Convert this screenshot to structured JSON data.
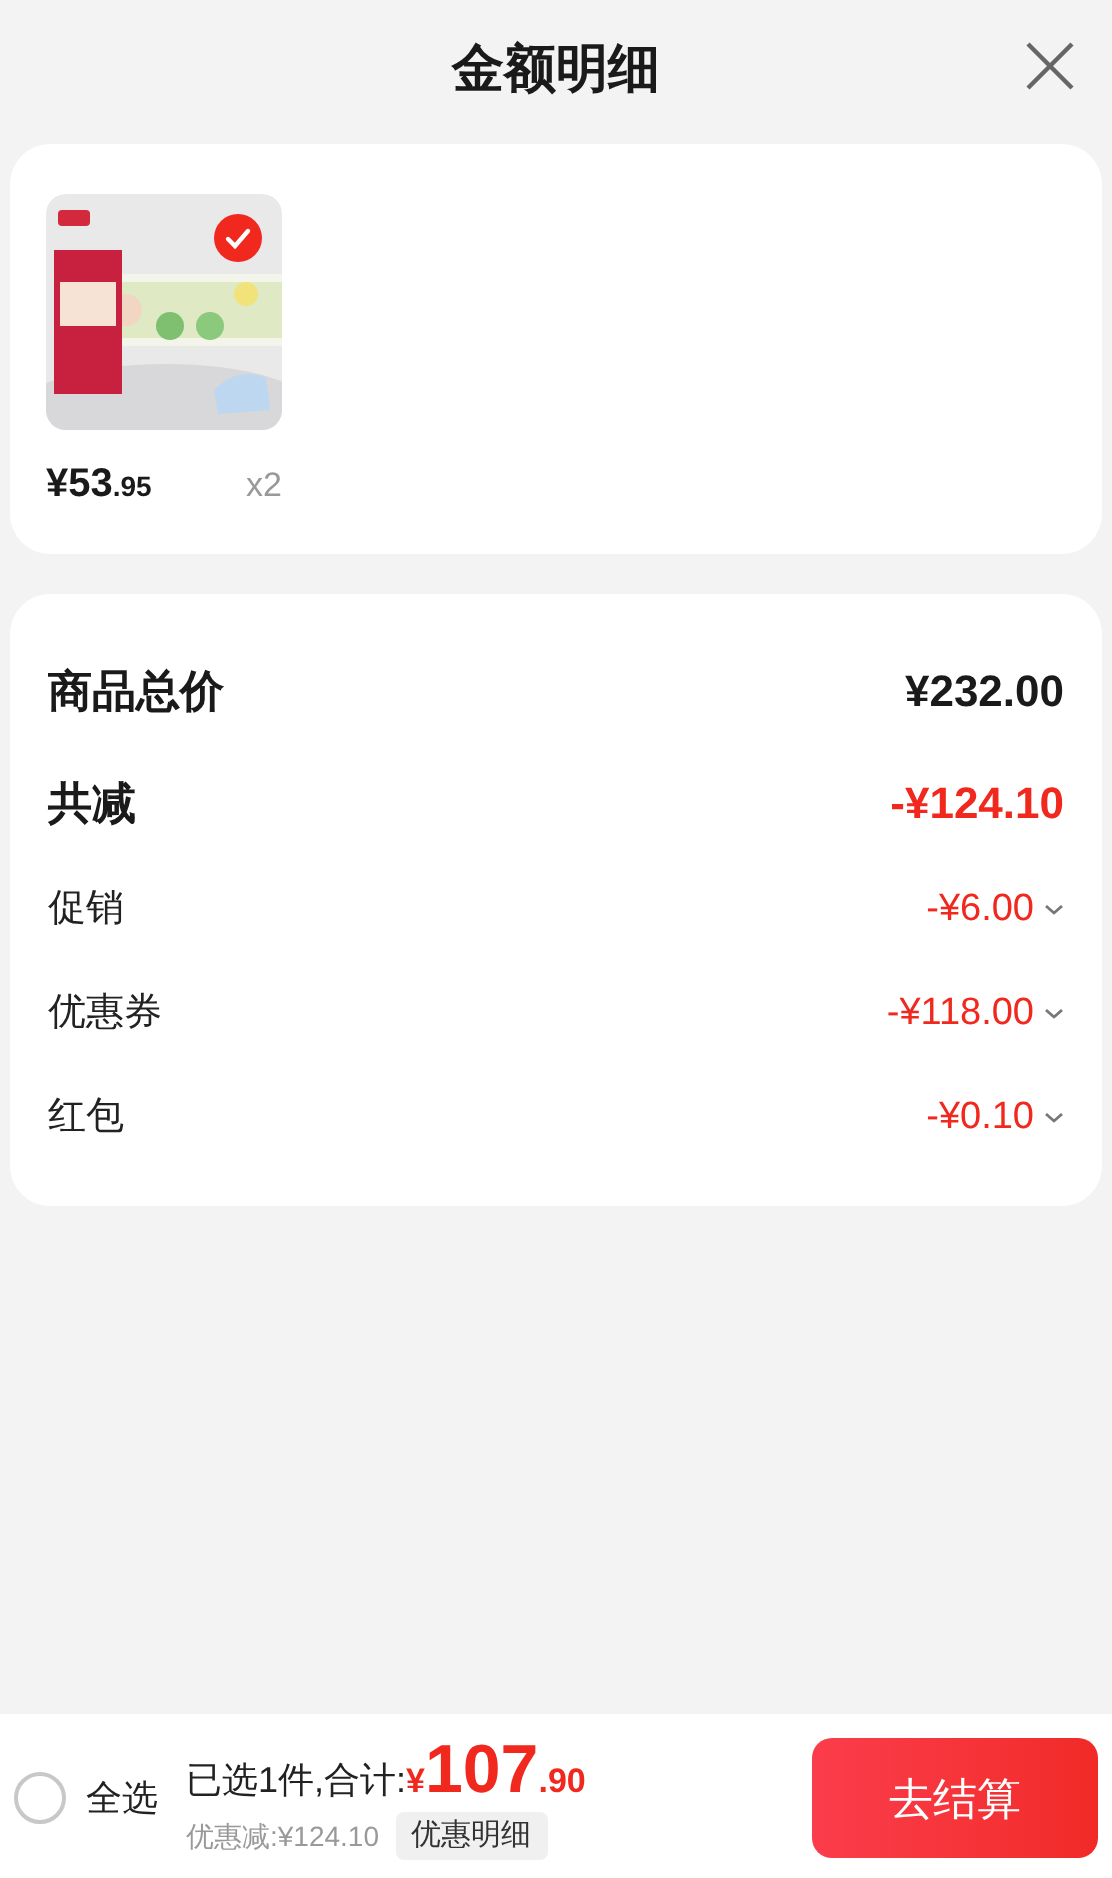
{
  "header": {
    "title": "金额明细"
  },
  "product": {
    "kind": "picture",
    "selected": true,
    "price_integer": "¥53",
    "price_decimal": ".95",
    "quantity": "x2"
  },
  "summary": [
    {
      "kind": "total",
      "label": "商品总价",
      "amount": "¥232.00"
    },
    {
      "kind": "discount",
      "label": "共减",
      "amount": "-¥124.10"
    },
    {
      "kind": "item",
      "label": "促销",
      "amount": "-¥6.00"
    },
    {
      "kind": "item",
      "label": "优惠券",
      "amount": "-¥118.00"
    },
    {
      "kind": "item",
      "label": "红包",
      "amount": "-¥0.10"
    }
  ],
  "bottom_bar": {
    "select_all": {
      "label": "全选",
      "checked": false
    },
    "selected_label": "已选1件,合计:",
    "currency": "¥",
    "total_integer": "107",
    "total_decimal": ".90",
    "discount_text": "优惠减:¥124.10",
    "details_button": "优惠明细",
    "checkout_button": "去结算"
  }
}
